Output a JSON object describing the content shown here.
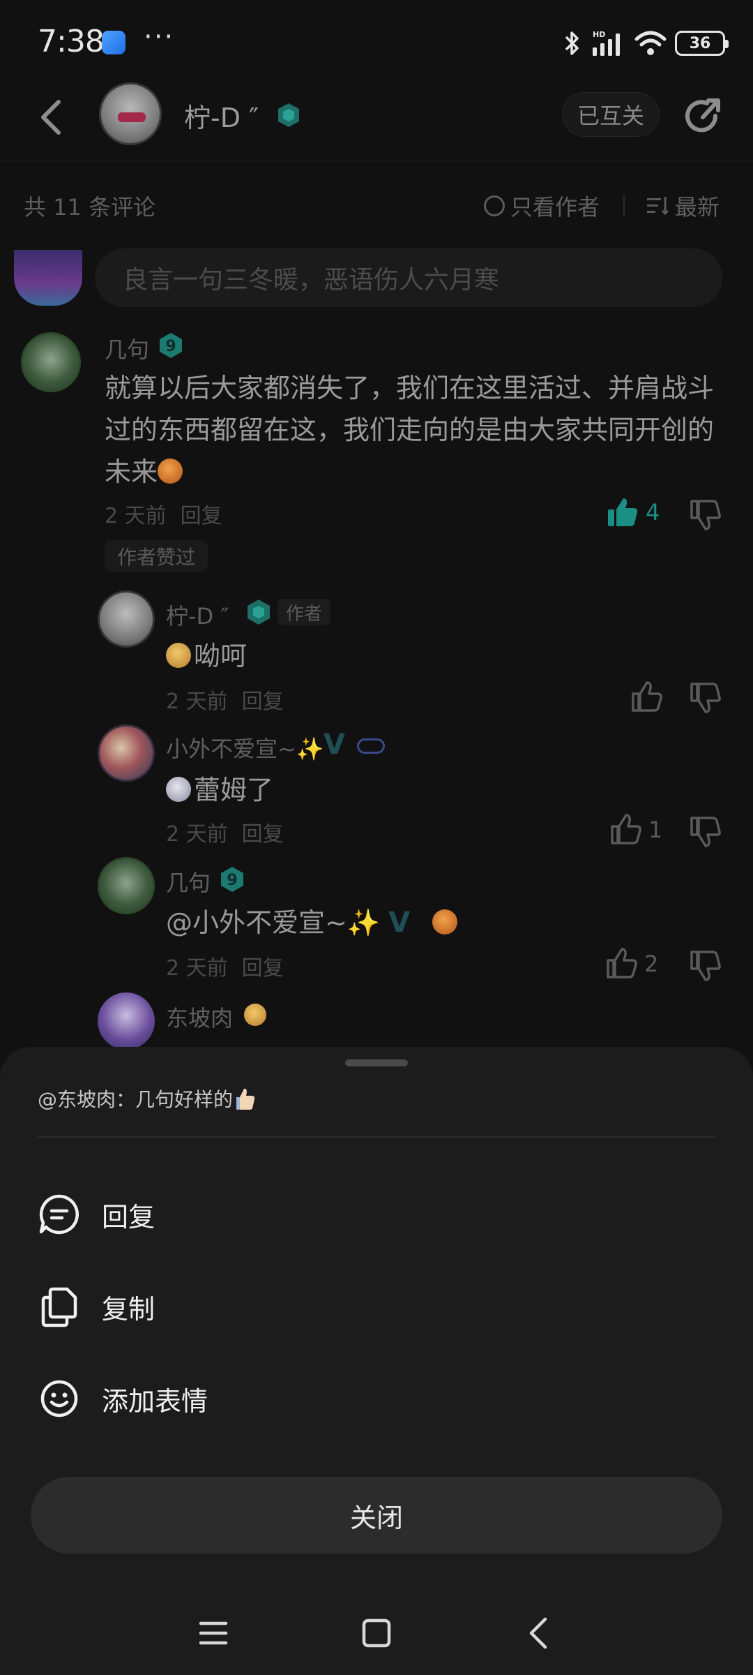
{
  "status_bar": {
    "time": "7:38",
    "battery": "36"
  },
  "header": {
    "name": "柠-D ″",
    "follow_label": "已互关"
  },
  "meta": {
    "count": "共 11 条评论",
    "author_only": "只看作者",
    "sort": "最新"
  },
  "input": {
    "placeholder": "良言一句三冬暖，恶语伤人六月寒"
  },
  "comments": [
    {
      "user": "几句",
      "text": "就算以后大家都消失了，我们在这里活过、并肩战斗过的东西都留在这，我们走向的是由大家共同开创的未来",
      "time": "2 天前",
      "reply": "回复",
      "likes": "4",
      "tag": "作者赞过"
    },
    {
      "user": "柠-D ″",
      "author_tag": "作者",
      "text": "呦呵",
      "time": "2 天前",
      "reply": "回复"
    },
    {
      "user": "小外不爱宣~✨",
      "text": "蕾姆了",
      "time": "2 天前",
      "reply": "回复",
      "likes": "1"
    },
    {
      "user": "几句",
      "text": "@小外不爱宣~✨",
      "time": "2 天前",
      "reply": "回复",
      "likes": "2"
    },
    {
      "user": "东坡肉"
    }
  ],
  "sheet": {
    "quote": "@东坡肉：几句好样的",
    "reply": "回复",
    "copy": "复制",
    "add_emoji": "添加表情",
    "close": "关闭"
  },
  "colors": {
    "accent": "#1b8f83",
    "sheet_bg": "#1c1c1c",
    "page_bg": "#111111"
  }
}
